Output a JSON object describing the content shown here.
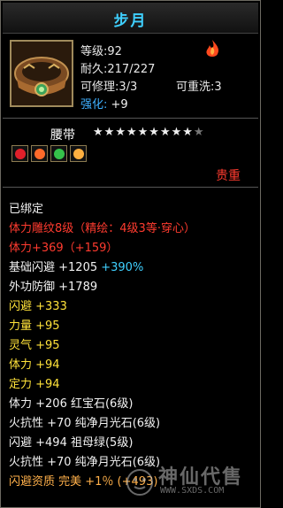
{
  "item": {
    "name": "步月",
    "level": "等级:92",
    "durability": "耐久:217/227",
    "repairable": "可修理:3/3",
    "rewashable": "可重洗:3",
    "enhance_label": "强化:",
    "enhance_value": "+9",
    "slot": "腰带",
    "stars_total": 10,
    "stars_lit": 9,
    "quality": "贵重"
  },
  "gems": [
    {
      "name": "red-gem",
      "color": "#e0202a"
    },
    {
      "name": "fire-gem",
      "color": "#ff6a2a"
    },
    {
      "name": "green-gem",
      "color": "#35c24a"
    },
    {
      "name": "moon-gem",
      "color": "#ffb040"
    }
  ],
  "attributes": [
    {
      "text": "已绑定",
      "color": "w"
    },
    {
      "text": "体力雕纹8级（精绘：4级3等·穿心）",
      "color": "r"
    },
    {
      "text": "体力+369（+159）",
      "color": "r"
    },
    {
      "text": "基础闪避 +1205 ",
      "color": "w",
      "extra": "+390%",
      "extra_color": "c"
    },
    {
      "text": "外功防御 +1789",
      "color": "w"
    },
    {
      "text": "闪避 +333",
      "color": "y"
    },
    {
      "text": "力量 +95",
      "color": "y"
    },
    {
      "text": "灵气 +95",
      "color": "y"
    },
    {
      "text": "体力 +94",
      "color": "y"
    },
    {
      "text": "定力 +94",
      "color": "y"
    },
    {
      "text": "体力 +206 红宝石(6级)",
      "color": "w"
    },
    {
      "text": "火抗性 +70 纯净月光石(6级)",
      "color": "w"
    },
    {
      "text": "闪避 +494 祖母绿(5级)",
      "color": "w"
    },
    {
      "text": "火抗性 +70 纯净月光石(6级)",
      "color": "w"
    },
    {
      "text": "闪避资质  完美  +1％ (+493)",
      "color": "o"
    }
  ],
  "watermark": {
    "text": "神仙代售",
    "url": "WWW.SXDS.COM"
  }
}
